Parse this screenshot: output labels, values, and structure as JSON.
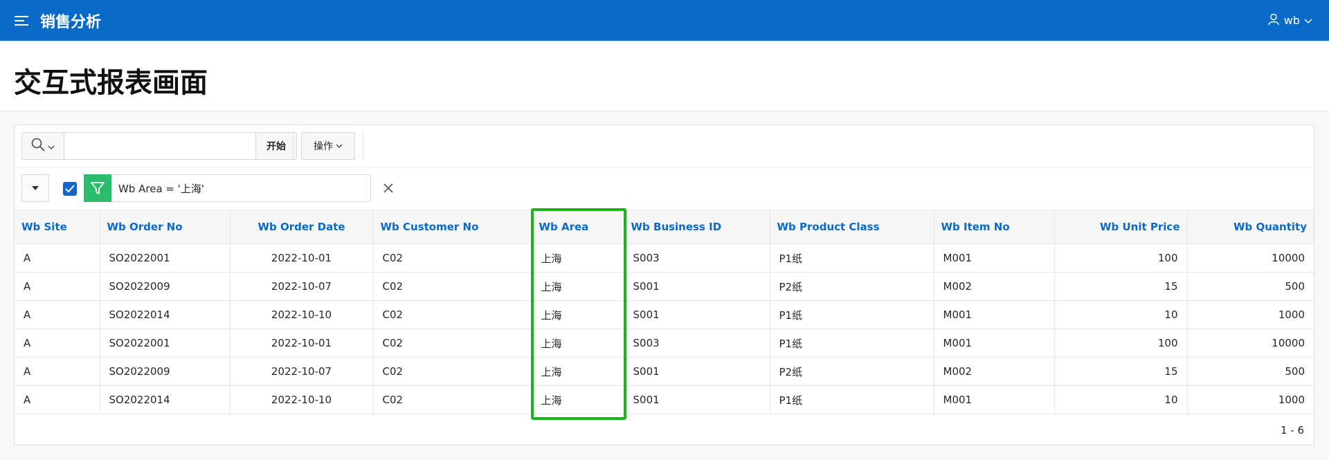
{
  "header": {
    "app_title": "销售分析",
    "user_name": "wb"
  },
  "page": {
    "title": "交互式报表画面"
  },
  "toolbar": {
    "search_placeholder": "",
    "go_label": "开始",
    "actions_label": "操作"
  },
  "filter": {
    "text": "Wb Area = '上海'",
    "enabled": true
  },
  "table": {
    "columns": [
      "Wb Site",
      "Wb Order No",
      "Wb Order Date",
      "Wb Customer No",
      "Wb Area",
      "Wb Business ID",
      "Wb Product Class",
      "Wb Item No",
      "Wb Unit Price",
      "Wb Quantity"
    ],
    "rows": [
      [
        "A",
        "SO2022001",
        "2022-10-01",
        "C02",
        "上海",
        "S003",
        "P1纸",
        "M001",
        "100",
        "10000"
      ],
      [
        "A",
        "SO2022009",
        "2022-10-07",
        "C02",
        "上海",
        "S001",
        "P2纸",
        "M002",
        "15",
        "500"
      ],
      [
        "A",
        "SO2022014",
        "2022-10-10",
        "C02",
        "上海",
        "S001",
        "P1纸",
        "M001",
        "10",
        "1000"
      ],
      [
        "A",
        "SO2022001",
        "2022-10-01",
        "C02",
        "上海",
        "S003",
        "P1纸",
        "M001",
        "100",
        "10000"
      ],
      [
        "A",
        "SO2022009",
        "2022-10-07",
        "C02",
        "上海",
        "S001",
        "P2纸",
        "M002",
        "15",
        "500"
      ],
      [
        "A",
        "SO2022014",
        "2022-10-10",
        "C02",
        "上海",
        "S001",
        "P1纸",
        "M001",
        "10",
        "1000"
      ]
    ]
  },
  "pagination": {
    "text": "1 - 6"
  },
  "colors": {
    "brand": "#0a6ac7",
    "filter_green": "#2bbb6c",
    "highlight": "#18b51c"
  }
}
